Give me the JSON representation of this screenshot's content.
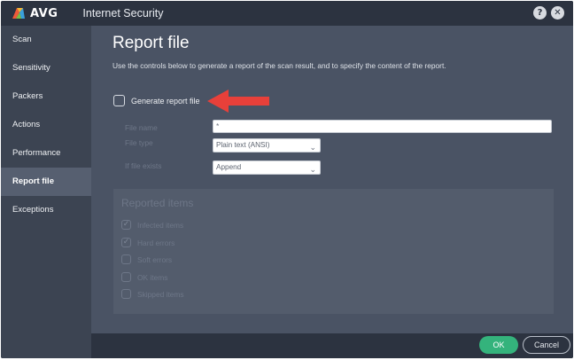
{
  "window": {
    "brand": "AVG",
    "title": "Internet Security",
    "help_glyph": "?",
    "close_glyph": "✕"
  },
  "sidebar": {
    "items": [
      {
        "label": "Scan",
        "active": false
      },
      {
        "label": "Sensitivity",
        "active": false
      },
      {
        "label": "Packers",
        "active": false
      },
      {
        "label": "Actions",
        "active": false
      },
      {
        "label": "Performance",
        "active": false
      },
      {
        "label": "Report file",
        "active": true
      },
      {
        "label": "Exceptions",
        "active": false
      }
    ]
  },
  "main": {
    "title": "Report file",
    "description": "Use the controls below to generate a report of the scan result, and to specify the content of the report.",
    "generate_checkbox": {
      "label": "Generate report file",
      "checked": false
    },
    "fields": {
      "file_name": {
        "label": "File name",
        "value": "*"
      },
      "file_type": {
        "label": "File type",
        "value": "Plain text (ANSI)"
      },
      "if_file_exists": {
        "label": "If file exists",
        "value": "Append"
      }
    },
    "reported_items": {
      "title": "Reported items",
      "items": [
        {
          "label": "Infected items",
          "checked": true
        },
        {
          "label": "Hard errors",
          "checked": true
        },
        {
          "label": "Soft errors",
          "checked": false
        },
        {
          "label": "OK items",
          "checked": false
        },
        {
          "label": "Skipped items",
          "checked": false
        }
      ]
    }
  },
  "footer": {
    "ok_label": "OK",
    "cancel_label": "Cancel"
  },
  "glyphs": {
    "check": "✓",
    "chevron": "⌄"
  },
  "icons": {
    "logo": "avg-logo-icon",
    "arrow": "red-arrow-annotation-icon"
  },
  "colors": {
    "accent_green": "#34b37c",
    "annotation_red": "#e8403a",
    "titlebar": "#2c3340",
    "sidebar": "#3c4452",
    "content": "#4a5364"
  }
}
